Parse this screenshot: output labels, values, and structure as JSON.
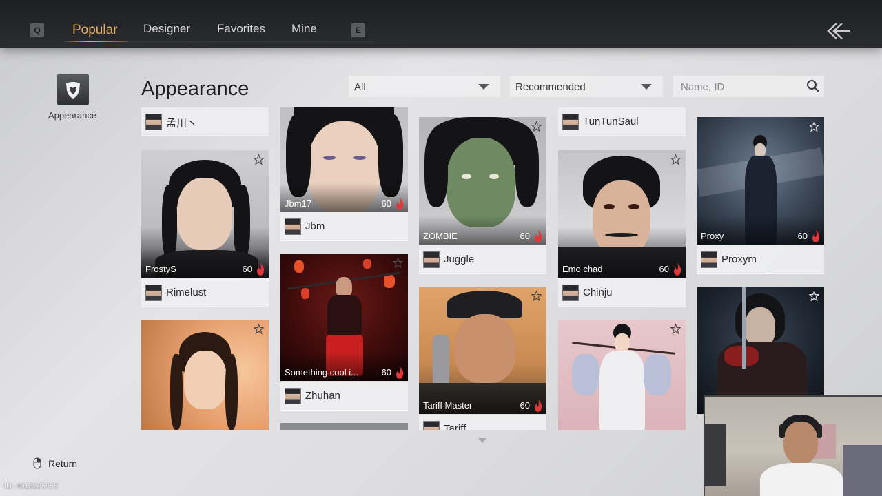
{
  "tabs": {
    "left_key": "Q",
    "right_key": "E",
    "items": [
      "Popular",
      "Designer",
      "Favorites",
      "Mine"
    ]
  },
  "sidebar": {
    "label": "Appearance"
  },
  "main": {
    "title": "Appearance",
    "filter_category": "All",
    "filter_sort": "Recommended",
    "search_placeholder": "Name, ID"
  },
  "cards": [
    {
      "author": "孟川丶"
    },
    {
      "name": "FrostyS",
      "count": "60",
      "author": "Rimelust"
    },
    {
      "author": ""
    },
    {
      "name": "Jbm17",
      "count": "60",
      "author": "Jbm"
    },
    {
      "name": "Something cool i...",
      "count": "60",
      "author": "Zhuhan"
    },
    {
      "name": "ZOMBIE",
      "count": "60",
      "author": "Juggle"
    },
    {
      "name": "Tariff Master",
      "count": "60",
      "author": "Tariff..."
    },
    {
      "author": "TunTunSaul"
    },
    {
      "name": "Emo chad",
      "count": "60",
      "author": "Chinju"
    },
    {
      "name": "Proxy",
      "count": "60",
      "author": "Proxym"
    }
  ],
  "footer": {
    "return_label": "Return",
    "id_label": "ID: 4013235055"
  },
  "colors": {
    "accent": "#e2b06a",
    "topbar": "#1d1f22",
    "flame": "#e0383a"
  }
}
